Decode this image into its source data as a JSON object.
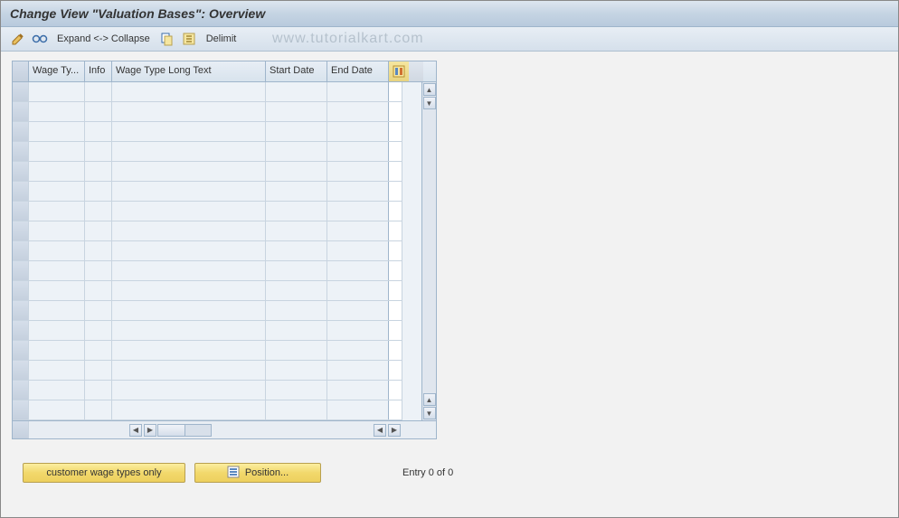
{
  "header": {
    "title": "Change View \"Valuation Bases\": Overview"
  },
  "toolbar": {
    "expand_collapse": "Expand <-> Collapse",
    "delimit": "Delimit",
    "watermark": "www.tutorialkart.com"
  },
  "table": {
    "columns": {
      "wage_type": "Wage Ty...",
      "info": "Info",
      "long_text": "Wage Type Long Text",
      "start_date": "Start Date",
      "end_date": "End Date"
    },
    "rows": []
  },
  "footer": {
    "customer_btn": "customer wage types only",
    "position_btn": "Position...",
    "entry_text": "Entry 0 of 0"
  },
  "icons": {
    "edit": "edit-icon",
    "glasses": "display-icon",
    "copy": "copy-icon",
    "select_all": "select-all-icon",
    "position": "position-icon",
    "config": "table-settings-icon"
  }
}
